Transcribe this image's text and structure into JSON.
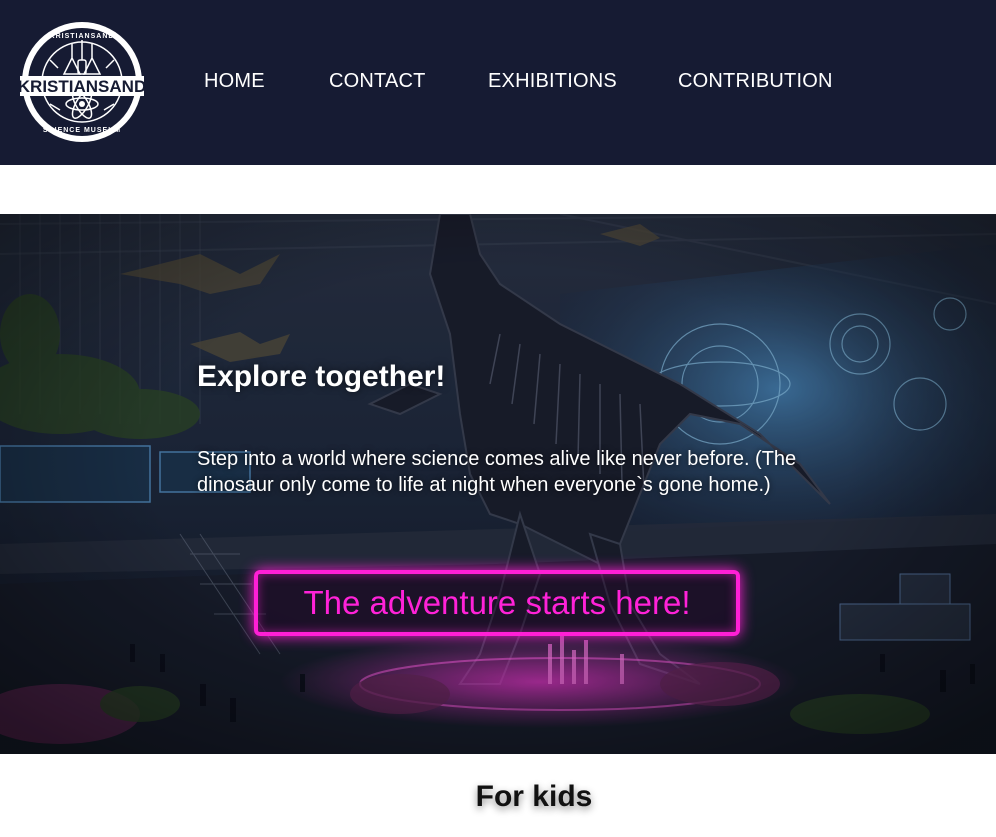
{
  "header": {
    "logo": {
      "icon": "science-museum-logo",
      "text_top": "KRISTIANSAND",
      "text_middle": "KRISTIANSAND",
      "text_bottom": "SCIENCE MUSEUM"
    },
    "nav": [
      {
        "label": "HOME"
      },
      {
        "label": "CONTACT"
      },
      {
        "label": "EXHIBITIONS"
      },
      {
        "label": "CONTRIBUTION"
      }
    ]
  },
  "hero": {
    "image": "dinosaur-skeleton-museum-hall",
    "title": "Explore together!",
    "text": "Step into a world where science comes alive like never before. (The dinosaur only come to life at night when everyone`s gone home.)",
    "cta_label": "The adventure starts here!"
  },
  "section": {
    "title": "For kids"
  },
  "colors": {
    "header_bg": "#161b33",
    "accent": "#ff1fd6",
    "text_light": "#ffffff"
  }
}
